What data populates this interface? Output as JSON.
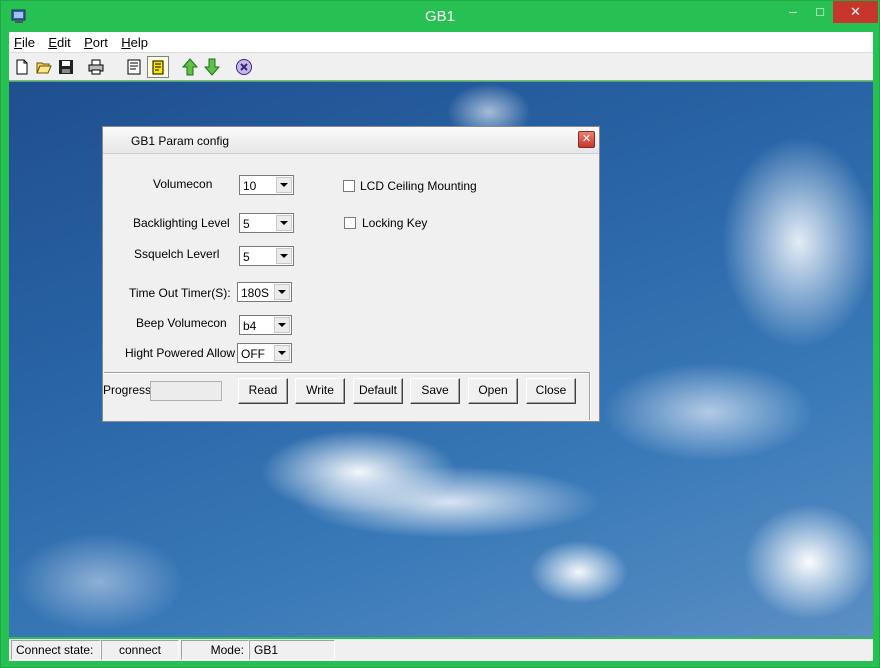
{
  "window": {
    "title": "GB1",
    "controls": [
      "–",
      "□",
      "✕"
    ]
  },
  "menu": [
    {
      "key": "F",
      "rest": "ile"
    },
    {
      "key": "E",
      "rest": "dit"
    },
    {
      "key": "P",
      "rest": "ort"
    },
    {
      "key": "H",
      "rest": "elp"
    }
  ],
  "toolbar": [
    "new-icon",
    "open-icon",
    "save-icon",
    "print-icon",
    "properties-icon",
    "note-icon",
    "upload-icon",
    "download-icon",
    "stop-icon"
  ],
  "dialog": {
    "title": "GB1 Param config",
    "close": "✕",
    "fields": {
      "volumecon": {
        "label": "Volumecon",
        "value": "10"
      },
      "backlighting": {
        "label": "Backlighting Level",
        "value": "5"
      },
      "squelch": {
        "label": "Ssquelch Leverl",
        "value": "5"
      },
      "timeout": {
        "label": "Time Out Timer(S):",
        "value": "180S"
      },
      "beep": {
        "label": "Beep Volumecon",
        "value": "b4"
      },
      "high_power": {
        "label": "Hight Powered Allow",
        "value": "OFF"
      }
    },
    "checkboxes": {
      "lcd": {
        "label": "LCD Ceiling Mounting",
        "checked": false
      },
      "lock": {
        "label": "Locking Key",
        "checked": false
      }
    },
    "progress": {
      "label": "Progress",
      "value": 0
    },
    "buttons": {
      "read": "Read",
      "write": "Write",
      "default": "Default",
      "save": "Save",
      "open": "Open",
      "close": "Close"
    }
  },
  "status": {
    "connect_label": "Connect state:",
    "connect_value": "connect",
    "mode_label": "Mode:",
    "mode_value": "GB1"
  }
}
